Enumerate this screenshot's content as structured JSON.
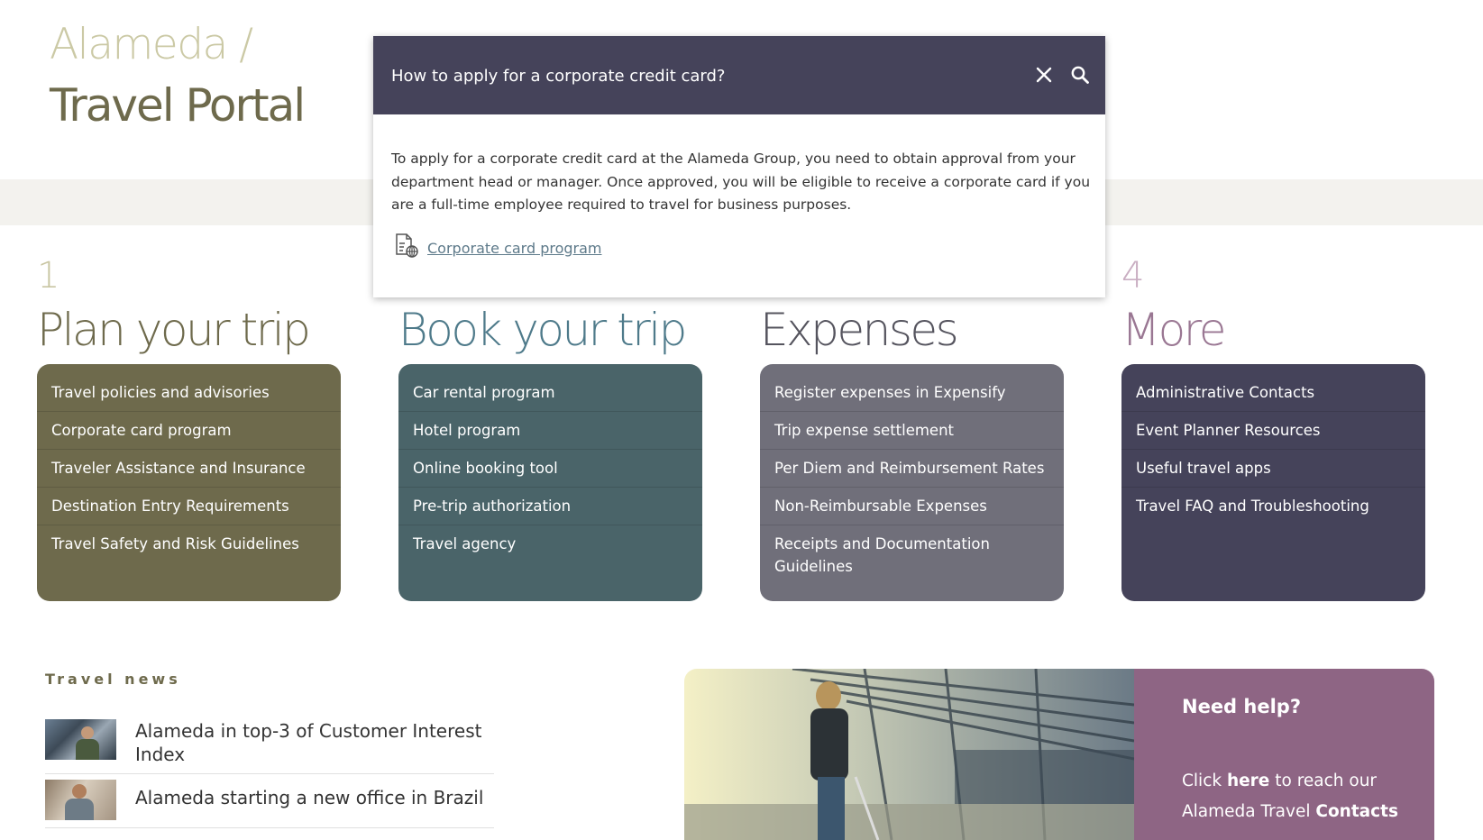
{
  "header": {
    "brand_top": "Alameda /",
    "brand_bottom": "Travel Portal"
  },
  "search": {
    "query": "How to apply for a corporate credit card?",
    "close_icon": "close-icon",
    "search_icon": "search-icon",
    "answer": "To apply for a corporate credit card at the Alameda Group, you need to obtain approval from your department head or manager. Once approved, you will be eligible to receive a corporate card if you are a full-time employee required to travel for business purposes.",
    "link_icon": "document-globe-icon",
    "link_label": "Corporate card program"
  },
  "sections": [
    {
      "number": "1",
      "title": "Plan your trip",
      "color": "#6e6a4c",
      "items": [
        "Travel policies and advisories",
        "Corporate card program",
        "Traveler Assistance and Insurance",
        "Destination Entry Requirements",
        "Travel Safety and Risk Guidelines"
      ]
    },
    {
      "title": "Book your trip",
      "color": "#4a6469",
      "items": [
        "Car rental program",
        "Hotel program",
        "Online booking tool",
        "Pre-trip authorization",
        "Travel agency"
      ]
    },
    {
      "title": "Expenses",
      "color": "#706f7a",
      "items": [
        "Register expenses in Expensify",
        "Trip expense settlement",
        "Per Diem and Reimbursement Rates",
        "Non-Reimbursable Expenses",
        "Receipts and Documentation Guidelines"
      ]
    },
    {
      "number": "4",
      "title": "More",
      "color": "#45435a",
      "items": [
        "Administrative Contacts",
        "Event Planner Resources",
        "Useful travel apps",
        "Travel FAQ and Troubleshooting"
      ]
    }
  ],
  "news": {
    "title": "Travel news",
    "items": [
      "Alameda in top-3 of Customer Interest Index",
      "Alameda starting a new office in Brazil"
    ]
  },
  "help": {
    "title": "Need help?",
    "prefix": "Click ",
    "here": "here",
    "middle": " to reach our Alameda Travel ",
    "contacts": "Contacts"
  },
  "colors": {
    "search_bar": "#45435a",
    "help_bg": "#8e6584",
    "band": "#f3f2ee",
    "plan": "#6e6a4c",
    "book": "#4a6469",
    "expenses": "#706f7a",
    "more": "#45435a"
  }
}
